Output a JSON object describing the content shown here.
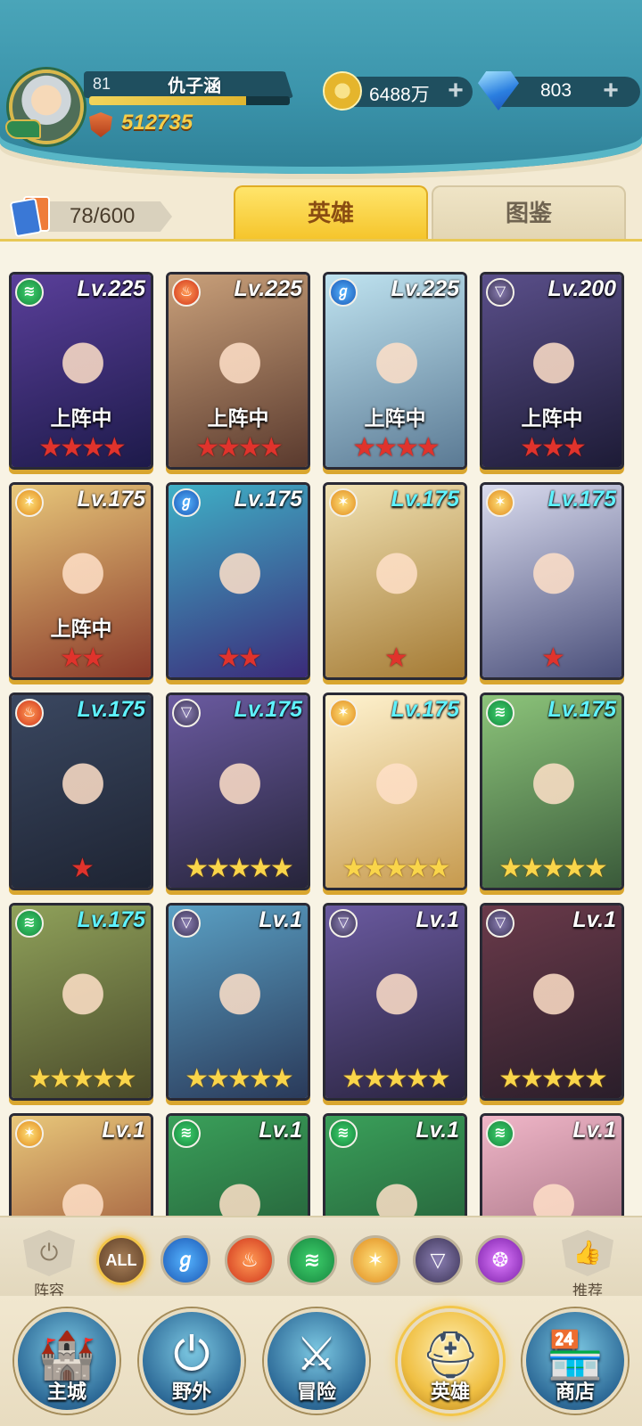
{
  "player": {
    "level": "81",
    "name": "仇子涵",
    "power": "512735",
    "xp_fraction": 0.78
  },
  "resources": {
    "gold": "6488万",
    "gems": "803",
    "gold_icon": "gold-coin-icon",
    "gem_icon": "diamond-icon"
  },
  "collection": {
    "count": "78/600"
  },
  "tabs": {
    "heroes": "英雄",
    "codex": "图鉴",
    "active": "heroes"
  },
  "heroes": [
    {
      "level": "Lv.225",
      "element": "nature",
      "stars": 4,
      "star_color": "red",
      "status": "上阵中",
      "lvl_color": "white",
      "bg": [
        "#5a3f9a",
        "#1d1a4a"
      ]
    },
    {
      "level": "Lv.225",
      "element": "fire",
      "stars": 4,
      "star_color": "red",
      "status": "上阵中",
      "lvl_color": "white",
      "bg": [
        "#c9a07a",
        "#5a3a2e"
      ]
    },
    {
      "level": "Lv.225",
      "element": "water",
      "stars": 4,
      "star_color": "red",
      "status": "上阵中",
      "lvl_color": "white",
      "bg": [
        "#bfe3f0",
        "#5b7a94"
      ]
    },
    {
      "level": "Lv.200",
      "element": "dark",
      "stars": 3,
      "star_color": "red",
      "status": "上阵中",
      "lvl_color": "white",
      "bg": [
        "#5a4f8a",
        "#1d1b36"
      ]
    },
    {
      "level": "Lv.175",
      "element": "light",
      "stars": 2,
      "star_color": "red",
      "status": "上阵中",
      "lvl_color": "white",
      "bg": [
        "#e8c77a",
        "#8a3a2a"
      ]
    },
    {
      "level": "Lv.175",
      "element": "water",
      "stars": 2,
      "star_color": "red",
      "status": "",
      "lvl_color": "white",
      "bg": [
        "#3fb0c6",
        "#3b2b7a"
      ]
    },
    {
      "level": "Lv.175",
      "element": "light",
      "stars": 1,
      "star_color": "red",
      "status": "",
      "lvl_color": "cyan",
      "bg": [
        "#f1e2b3",
        "#a47a34"
      ]
    },
    {
      "level": "Lv.175",
      "element": "light",
      "stars": 1,
      "star_color": "red",
      "status": "",
      "lvl_color": "cyan",
      "bg": [
        "#d9dbee",
        "#4a4f7a"
      ]
    },
    {
      "level": "Lv.175",
      "element": "fire",
      "stars": 1,
      "star_color": "red",
      "status": "",
      "lvl_color": "cyan",
      "bg": [
        "#3a4760",
        "#1e2433"
      ]
    },
    {
      "level": "Lv.175",
      "element": "dark",
      "stars": 5,
      "star_color": "gold",
      "status": "",
      "lvl_color": "cyan",
      "bg": [
        "#6a5aa0",
        "#26243a"
      ]
    },
    {
      "level": "Lv.175",
      "element": "light",
      "stars": 5,
      "star_color": "gold",
      "status": "",
      "lvl_color": "cyan",
      "bg": [
        "#fff3d0",
        "#c69a4e"
      ]
    },
    {
      "level": "Lv.175",
      "element": "nature",
      "stars": 5,
      "star_color": "gold",
      "status": "",
      "lvl_color": "cyan",
      "bg": [
        "#8cc47a",
        "#3a5a3a"
      ]
    },
    {
      "level": "Lv.175",
      "element": "nature",
      "stars": 5,
      "star_color": "gold",
      "status": "",
      "lvl_color": "cyan",
      "bg": [
        "#8fa15a",
        "#4a4a2a"
      ]
    },
    {
      "level": "Lv.1",
      "element": "dark",
      "stars": 5,
      "star_color": "gold",
      "status": "",
      "lvl_color": "white",
      "bg": [
        "#5aa0c4",
        "#2a3a5a"
      ]
    },
    {
      "level": "Lv.1",
      "element": "dark",
      "stars": 5,
      "star_color": "gold",
      "status": "",
      "lvl_color": "white",
      "bg": [
        "#6a5aa0",
        "#2a2440"
      ]
    },
    {
      "level": "Lv.1",
      "element": "dark",
      "stars": 5,
      "star_color": "gold",
      "status": "",
      "lvl_color": "white",
      "bg": [
        "#6a3a4a",
        "#2a1e2a"
      ]
    },
    {
      "level": "Lv.1",
      "element": "light",
      "stars": 0,
      "star_color": "gold",
      "status": "",
      "lvl_color": "white",
      "bg": [
        "#e8c77a",
        "#8a3a2a"
      ]
    },
    {
      "level": "Lv.1",
      "element": "nature",
      "stars": 0,
      "star_color": "gold",
      "status": "",
      "lvl_color": "white",
      "bg": [
        "#3aa05a",
        "#1e4a2e"
      ]
    },
    {
      "level": "Lv.1",
      "element": "nature",
      "stars": 0,
      "star_color": "gold",
      "status": "",
      "lvl_color": "white",
      "bg": [
        "#3aa05a",
        "#1e4a2e"
      ]
    },
    {
      "level": "Lv.1",
      "element": "nature",
      "stars": 0,
      "star_color": "gold",
      "status": "",
      "lvl_color": "white",
      "bg": [
        "#f0b6c8",
        "#8a5a6a"
      ]
    }
  ],
  "filters": {
    "lineup_label": "阵容",
    "recommend_label": "推荐",
    "all_label": "ALL",
    "elements": [
      "water",
      "fire",
      "nature",
      "light",
      "dark",
      "arcane"
    ]
  },
  "nav": {
    "items": [
      {
        "label": "主城",
        "icon": "castle-icon"
      },
      {
        "label": "野外",
        "icon": "portal-icon"
      },
      {
        "label": "冒险",
        "icon": "sword-icon"
      },
      {
        "label": "英雄",
        "icon": "knight-helmet-icon"
      },
      {
        "label": "商店",
        "icon": "shop-icon"
      }
    ],
    "active": "英雄"
  }
}
